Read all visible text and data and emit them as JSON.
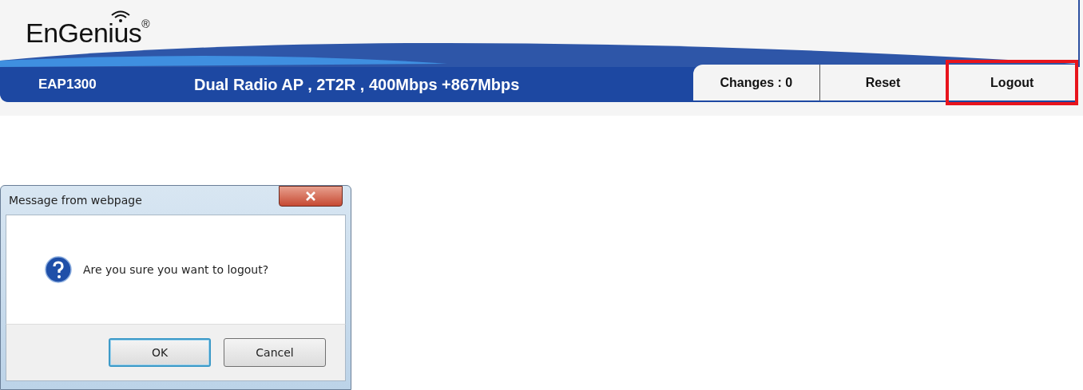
{
  "header": {
    "logo": "EnGenius$^{®}$",
    "model": "EAP1300",
    "description": "Dual Radio AP , 2T2R , 400Mbps +867Mbps",
    "buttons": [
      {
        "label": "Changes : 0",
        "highlighted": false
      },
      {
        "label": "Reset",
        "highlighted": false
      },
      {
        "label": "Logout",
        "highlighted": true
      }
    ]
  },
  "dialog": {
    "title": "Message from webpage",
    "message": "Are you sure you want to logout?",
    "buttons": [
      {
        "label": "OK",
        "focused": true
      },
      {
        "label": "Cancel",
        "focused": false
      }
    ]
  }
}
